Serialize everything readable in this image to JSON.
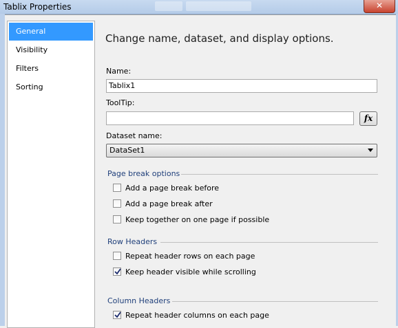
{
  "window": {
    "title": "Tablix Properties",
    "close_glyph": "✕"
  },
  "sidebar": {
    "items": [
      {
        "label": "General",
        "selected": true
      },
      {
        "label": "Visibility",
        "selected": false
      },
      {
        "label": "Filters",
        "selected": false
      },
      {
        "label": "Sorting",
        "selected": false
      }
    ]
  },
  "main": {
    "heading": "Change name, dataset, and display options.",
    "name_label": "Name:",
    "name_value": "Tablix1",
    "tooltip_label": "ToolTip:",
    "tooltip_value": "",
    "fx_label": "fx",
    "dataset_label": "Dataset name:",
    "dataset_value": "DataSet1"
  },
  "page_break": {
    "title": "Page break options",
    "options": [
      {
        "label": "Add a page break before",
        "checked": false
      },
      {
        "label": "Add a page break after",
        "checked": false
      },
      {
        "label": "Keep together on one page if possible",
        "checked": false
      }
    ]
  },
  "row_headers": {
    "title": "Row Headers",
    "options": [
      {
        "label": "Repeat header rows on each page",
        "checked": false
      },
      {
        "label": "Keep header visible while scrolling",
        "checked": true
      }
    ]
  },
  "column_headers": {
    "title": "Column Headers",
    "options": [
      {
        "label": "Repeat header columns on each page",
        "checked": true
      }
    ]
  }
}
